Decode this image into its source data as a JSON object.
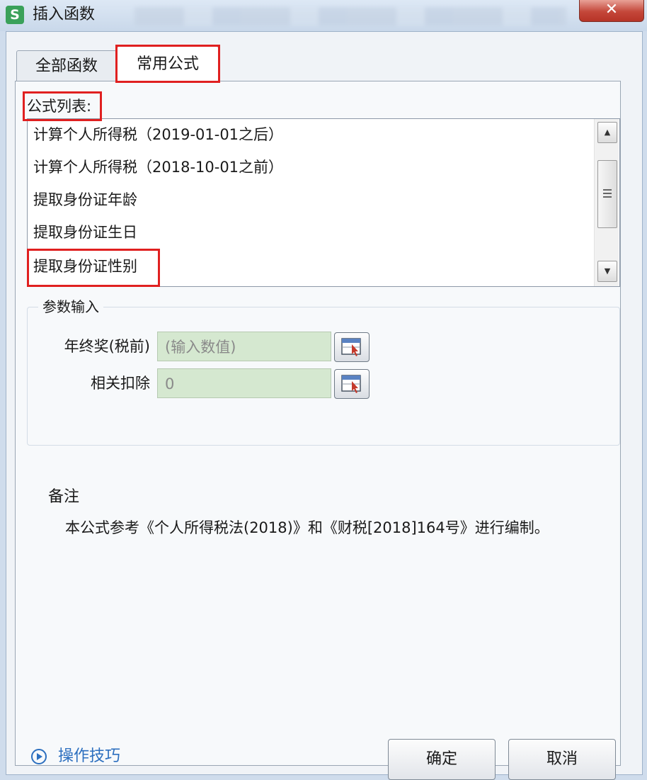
{
  "window": {
    "title": "插入函数",
    "app_icon_letter": "S",
    "close_glyph": "✕"
  },
  "tabs": [
    {
      "label": "全部函数",
      "active": false
    },
    {
      "label": "常用公式",
      "active": true
    }
  ],
  "formula_list": {
    "label": "公式列表:",
    "items": [
      "计算个人所得税（2019-01-01之后）",
      "计算个人所得税（2018-10-01之前）",
      "提取身份证年龄",
      "提取身份证生日",
      "提取身份证性别"
    ]
  },
  "params": {
    "title": "参数输入",
    "fields": [
      {
        "label": "年终奖(税前)",
        "value": "(输入数值)"
      },
      {
        "label": "相关扣除",
        "value": "0"
      }
    ]
  },
  "note": {
    "title": "备注",
    "text": "本公式参考《个人所得税法(2018)》和《财税[2018]164号》进行编制。"
  },
  "footer": {
    "tips_link": "操作技巧",
    "ok_label": "确定",
    "cancel_label": "取消"
  },
  "colors": {
    "highlight": "#e02020",
    "link": "#2c6fbf",
    "input_bg": "#d5e8d0",
    "icon_green": "#3aa15a"
  }
}
